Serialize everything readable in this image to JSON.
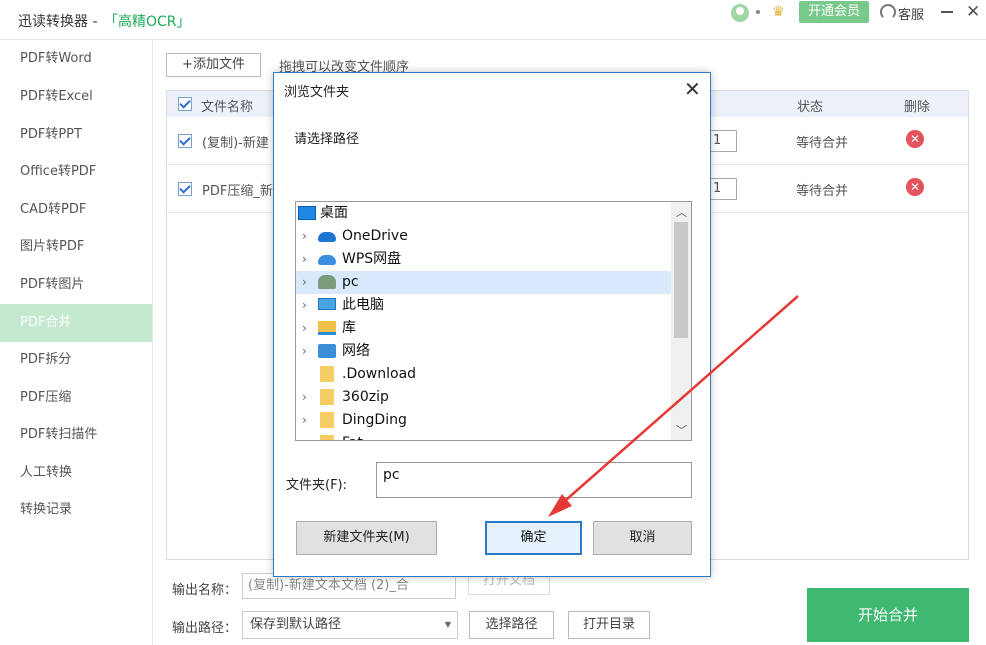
{
  "app": {
    "title": "迅读转换器 -",
    "title_accent": "「高精OCR」",
    "vip_label": "开通会员",
    "support_label": "客服",
    "close_glyph": "✕",
    "crown_glyph": "♛"
  },
  "sidebar": {
    "items": [
      {
        "label": "PDF转Word"
      },
      {
        "label": "PDF转Excel"
      },
      {
        "label": "PDF转PPT"
      },
      {
        "label": "Office转PDF"
      },
      {
        "label": "CAD转PDF"
      },
      {
        "label": "图片转PDF"
      },
      {
        "label": "PDF转图片"
      },
      {
        "label": "PDF合并"
      },
      {
        "label": "PDF拆分"
      },
      {
        "label": "PDF压缩"
      },
      {
        "label": "PDF转扫描件"
      },
      {
        "label": "人工转换"
      },
      {
        "label": "转换记录"
      }
    ],
    "active": "PDF合并"
  },
  "toolbar": {
    "add_file_label": "+添加文件",
    "drag_hint": "拖拽可以改变文件顺序"
  },
  "file_table": {
    "columns": {
      "name": "文件名称",
      "status": "状态",
      "delete": "删除"
    },
    "rows": [
      {
        "name": "(复制)-新建",
        "page": "1",
        "status": "等待合并",
        "delete_glyph": "✕"
      },
      {
        "name": "PDF压缩_新",
        "page": "1",
        "status": "等待合并",
        "delete_glyph": "✕"
      }
    ]
  },
  "output": {
    "name_label": "输出名称：",
    "name_value": "(复制)-新建文本文档 (2)_合",
    "open_file_label": "打开文档",
    "path_label": "输出路径：",
    "path_value": "保存到默认路径",
    "choose_path_label": "选择路径",
    "open_dir_label": "打开目录",
    "start_label": "开始合并"
  },
  "dialog": {
    "title": "浏览文件夹",
    "close_glyph": "✕",
    "prompt": "请选择路径",
    "tree": [
      {
        "label": "桌面",
        "icon": "desktop-icon",
        "expander": false
      },
      {
        "label": "OneDrive",
        "icon": "onedrive-icon",
        "expander": true
      },
      {
        "label": "WPS网盘",
        "icon": "wps-cloud-icon",
        "expander": true
      },
      {
        "label": "pc",
        "icon": "user-icon",
        "expander": true,
        "selected": true
      },
      {
        "label": "此电脑",
        "icon": "computer-icon",
        "expander": true
      },
      {
        "label": "库",
        "icon": "library-icon",
        "expander": true
      },
      {
        "label": "网络",
        "icon": "network-icon",
        "expander": true
      },
      {
        "label": ".Download",
        "icon": "folder-icon",
        "expander": false
      },
      {
        "label": "360zip",
        "icon": "folder-icon",
        "expander": true
      },
      {
        "label": "DingDing",
        "icon": "folder-icon",
        "expander": true
      },
      {
        "label": "Fat",
        "icon": "folder-icon",
        "expander": false
      }
    ],
    "folder_label": "文件夹(F):",
    "folder_value": "pc",
    "new_folder_label": "新建文件夹(M)",
    "ok_label": "确定",
    "cancel_label": "取消"
  },
  "colors": {
    "accent_green": "#3fb872",
    "sidebar_active": "#c5e9cf",
    "dialog_border": "#2a7ac8",
    "annotation_arrow": "#e53935"
  }
}
